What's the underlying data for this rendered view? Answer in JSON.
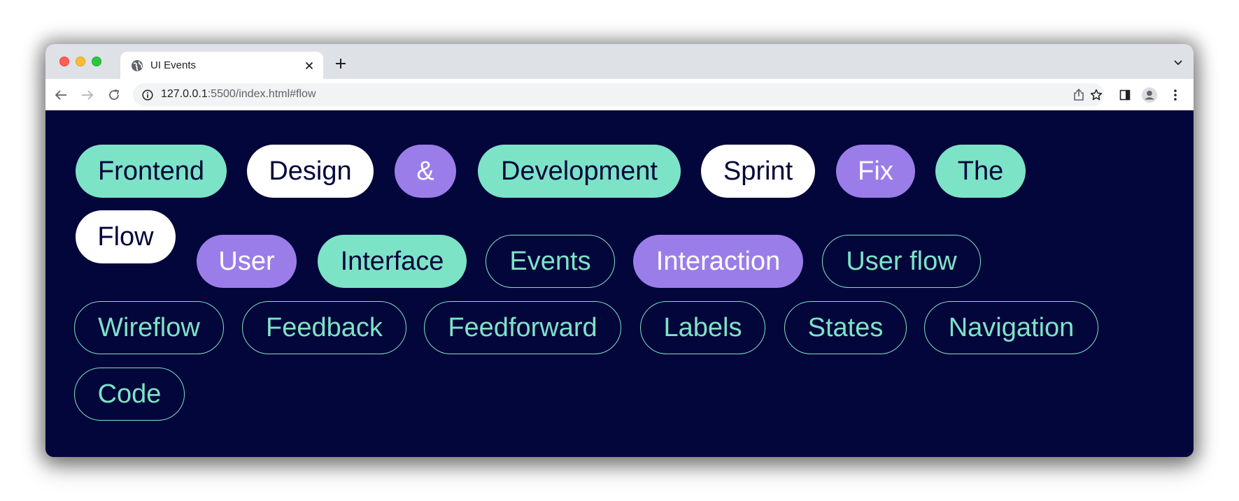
{
  "browser": {
    "tab_title": "UI Events",
    "url_host": "127.0.0.1",
    "url_path": ":5500/index.html#flow",
    "icons": {
      "favicon": "globe-icon",
      "close": "close-icon",
      "new_tab": "plus-icon",
      "tab_search": "chevron-down-icon",
      "back": "arrow-left-icon",
      "forward": "arrow-right-icon",
      "reload": "reload-icon",
      "site_info": "info-icon",
      "share": "share-icon",
      "bookmark": "star-icon",
      "side_panel": "side-panel-icon",
      "profile": "profile-icon",
      "menu": "kebab-menu-icon"
    }
  },
  "colors": {
    "background": "#03063a",
    "mint": "#7de3c7",
    "purple": "#9b7de9",
    "white": "#ffffff"
  },
  "chips": [
    {
      "label": "Frontend",
      "style": "mint"
    },
    {
      "label": "Design",
      "style": "white"
    },
    {
      "label": "&",
      "style": "purple"
    },
    {
      "label": "Development",
      "style": "mint"
    },
    {
      "label": "Sprint",
      "style": "white"
    },
    {
      "label": "Fix",
      "style": "purple"
    },
    {
      "label": "The",
      "style": "mint"
    },
    {
      "label": "Flow",
      "style": "white"
    },
    {
      "label": "User",
      "style": "purple"
    },
    {
      "label": "Interface",
      "style": "mint"
    },
    {
      "label": "Events",
      "style": "outline"
    },
    {
      "label": "Interaction",
      "style": "purple"
    },
    {
      "label": "User flow",
      "style": "outline"
    },
    {
      "label": "Wireflow",
      "style": "outline"
    },
    {
      "label": "Feedback",
      "style": "outline"
    },
    {
      "label": "Feedforward",
      "style": "outline"
    },
    {
      "label": "Labels",
      "style": "outline"
    },
    {
      "label": "States",
      "style": "outline"
    },
    {
      "label": "Navigation",
      "style": "outline"
    },
    {
      "label": "Code",
      "style": "outline"
    }
  ]
}
